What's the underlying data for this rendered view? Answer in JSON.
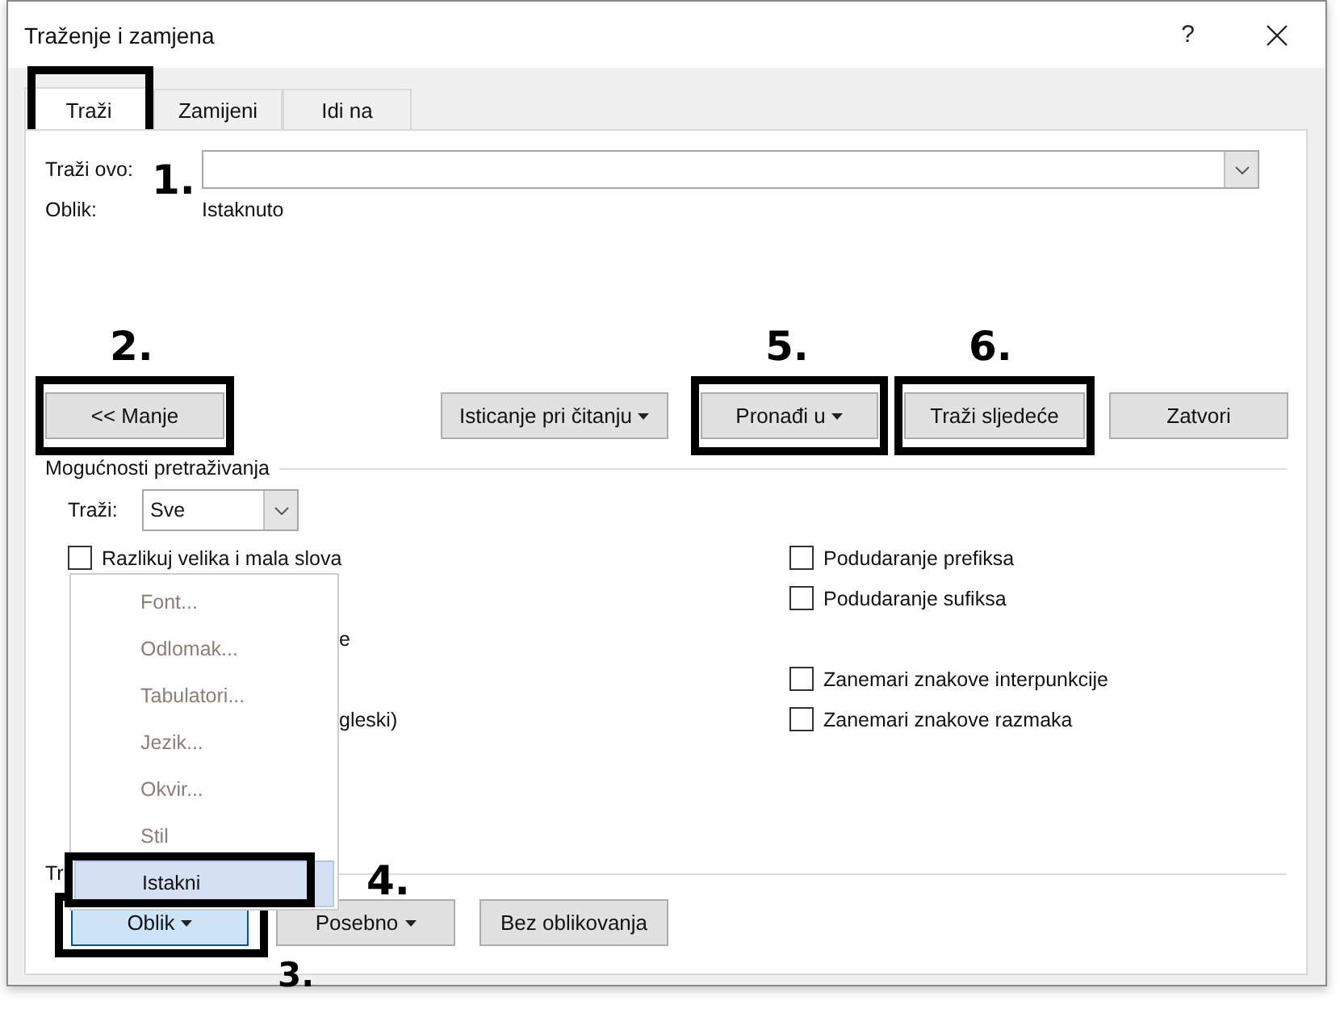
{
  "window": {
    "title": "Traženje i zamjena",
    "help": "?"
  },
  "tabs": [
    {
      "label": "Traži",
      "selected": true,
      "framed": true
    },
    {
      "label": "Zamijeni",
      "selected": false,
      "framed": false
    },
    {
      "label": "Idi na",
      "selected": false,
      "framed": false
    }
  ],
  "find": {
    "label": "Traži ovo:",
    "callout": "1."
  },
  "format": {
    "label": "Oblik:",
    "value": "Istaknuto"
  },
  "buttons": [
    {
      "label": "<< Manje",
      "dropdown": false,
      "framed": true,
      "callout": "2."
    },
    {
      "label": "Isticanje pri čitanju",
      "dropdown": true,
      "framed": false
    },
    {
      "label": "Pronađi u",
      "dropdown": true,
      "framed": true,
      "callout": "5."
    },
    {
      "label": "Traži sljedeće",
      "dropdown": false,
      "framed": true,
      "callout": "6."
    },
    {
      "label": "Zatvori",
      "dropdown": false,
      "framed": false
    }
  ],
  "options": {
    "title": "Mogućnosti pretraživanja",
    "search_label": "Traži:",
    "search_value": "Sve",
    "left": [
      {
        "kind": "checkbox",
        "label": "Razlikuj velika i mala slova",
        "checked": false
      },
      {
        "kind": "fragment",
        "label": "e"
      },
      {
        "kind": "fragment",
        "label": "gleski)"
      }
    ],
    "right": [
      {
        "label": "Podudaranje prefiksa",
        "checked": false
      },
      {
        "label": "Podudaranje sufiksa",
        "checked": false
      },
      {
        "label": "Zanemari znakove interpunkcije",
        "checked": false
      },
      {
        "label": "Zanemari znakove razmaka",
        "checked": false
      }
    ]
  },
  "replace_title": "Tr",
  "menu": [
    {
      "label": "Font...",
      "disabled": true,
      "selected": false
    },
    {
      "label": "Odlomak...",
      "disabled": true,
      "selected": false
    },
    {
      "label": "Tabulatori...",
      "disabled": true,
      "selected": false
    },
    {
      "label": "Jezik...",
      "disabled": true,
      "selected": false
    },
    {
      "label": "Okvir...",
      "disabled": true,
      "selected": false
    },
    {
      "label": "Stil",
      "disabled": true,
      "selected": false
    },
    {
      "label": "Istakni",
      "disabled": false,
      "selected": true,
      "framed": true,
      "callout": "4."
    }
  ],
  "bottom_buttons": [
    {
      "label": "Oblik",
      "dropdown": true,
      "pressed": true,
      "framed": true,
      "callout": "3."
    },
    {
      "label": "Posebno",
      "dropdown": true,
      "pressed": false,
      "framed": false
    },
    {
      "label": "Bez oblikovanja",
      "dropdown": false,
      "pressed": false,
      "framed": false
    }
  ]
}
